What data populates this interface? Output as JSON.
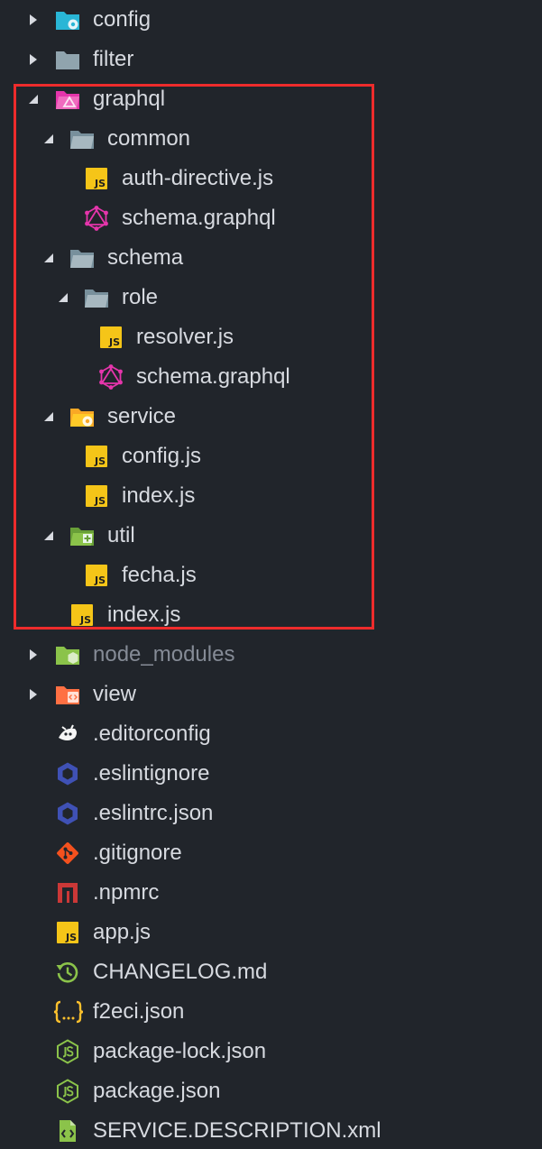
{
  "explorer": {
    "items": [
      {
        "label": "config",
        "icon": "config-folder-icon",
        "arrow": "collapsed"
      },
      {
        "label": "filter",
        "icon": "folder-icon",
        "arrow": "collapsed"
      },
      {
        "label": "graphql",
        "icon": "graphql-folder-icon",
        "arrow": "expanded"
      },
      {
        "label": "common",
        "icon": "folder-open-icon",
        "arrow": "expanded"
      },
      {
        "label": "auth-directive.js",
        "icon": "javascript-file-icon"
      },
      {
        "label": "schema.graphql",
        "icon": "graphql-file-icon"
      },
      {
        "label": "schema",
        "icon": "folder-open-icon",
        "arrow": "expanded"
      },
      {
        "label": "role",
        "icon": "folder-open-icon",
        "arrow": "expanded"
      },
      {
        "label": "resolver.js",
        "icon": "javascript-file-icon"
      },
      {
        "label": "schema.graphql",
        "icon": "graphql-file-icon"
      },
      {
        "label": "service",
        "icon": "service-folder-icon",
        "arrow": "expanded"
      },
      {
        "label": "config.js",
        "icon": "javascript-file-icon"
      },
      {
        "label": "index.js",
        "icon": "javascript-file-icon"
      },
      {
        "label": "util",
        "icon": "util-folder-icon",
        "arrow": "expanded"
      },
      {
        "label": "fecha.js",
        "icon": "javascript-file-icon"
      },
      {
        "label": "index.js",
        "icon": "javascript-file-icon"
      },
      {
        "label": "node_modules",
        "icon": "node-folder-icon",
        "arrow": "collapsed"
      },
      {
        "label": "view",
        "icon": "view-folder-icon",
        "arrow": "collapsed"
      },
      {
        "label": ".editorconfig",
        "icon": "editorconfig-icon"
      },
      {
        "label": ".eslintignore",
        "icon": "eslint-icon"
      },
      {
        "label": ".eslintrc.json",
        "icon": "eslint-icon"
      },
      {
        "label": ".gitignore",
        "icon": "git-icon"
      },
      {
        "label": ".npmrc",
        "icon": "npm-icon"
      },
      {
        "label": "app.js",
        "icon": "javascript-file-icon"
      },
      {
        "label": "CHANGELOG.md",
        "icon": "history-icon"
      },
      {
        "label": "f2eci.json",
        "icon": "json-braces-icon"
      },
      {
        "label": "package-lock.json",
        "icon": "nodejs-icon"
      },
      {
        "label": "package.json",
        "icon": "nodejs-icon"
      },
      {
        "label": "SERVICE.DESCRIPTION.xml",
        "icon": "xml-file-icon"
      }
    ]
  },
  "colors": {
    "background": "#21252b",
    "text": "#d7dae0",
    "dim_text": "#858b96",
    "highlight_border": "#ee2c2c",
    "javascript": "#f5c518",
    "graphql": "#e535ab",
    "folder": "#90a4ae",
    "config_folder": "#29b6d6",
    "node": "#8bc34a",
    "view": "#ff7043",
    "eslint": "#3f51b5",
    "git": "#f4511e",
    "npm": "#cb3837"
  }
}
